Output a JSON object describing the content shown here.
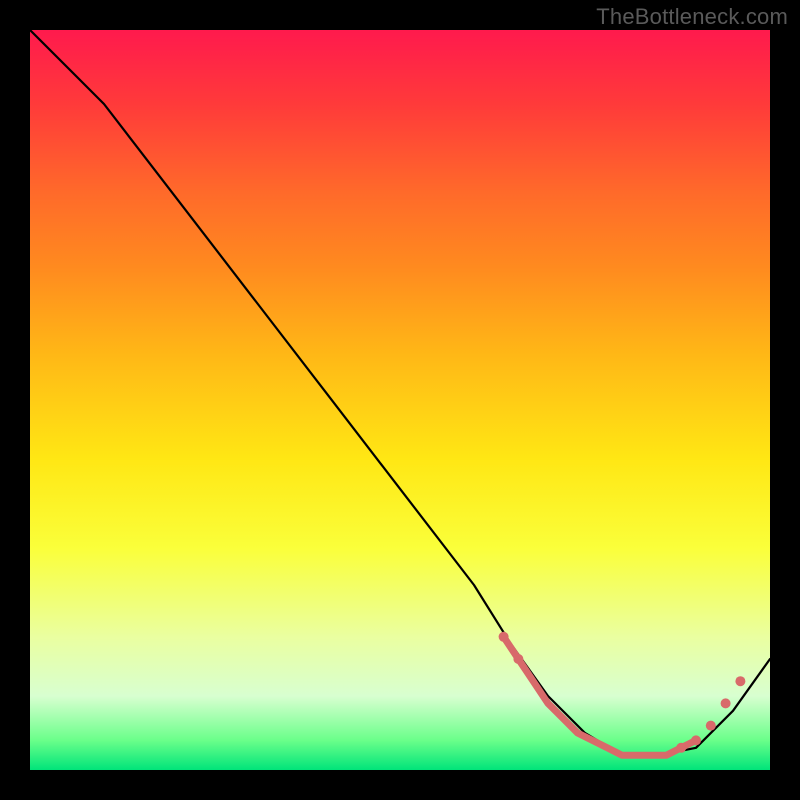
{
  "watermark": "TheBottleneck.com",
  "chart_data": {
    "type": "line",
    "title": "",
    "xlabel": "",
    "ylabel": "",
    "xlim": [
      0,
      100
    ],
    "ylim": [
      0,
      100
    ],
    "grid": false,
    "legend": false,
    "curve": {
      "name": "bottleneck-curve",
      "color": "#000000",
      "x": [
        0,
        6,
        10,
        20,
        30,
        40,
        50,
        60,
        65,
        70,
        75,
        80,
        85,
        90,
        95,
        100
      ],
      "y": [
        100,
        94,
        90,
        77,
        64,
        51,
        38,
        25,
        17,
        10,
        5,
        2,
        2,
        3,
        8,
        15
      ]
    },
    "highlight_band": {
      "name": "optimal-range-markers",
      "color": "#d86a6a",
      "x": [
        64,
        66,
        68,
        70,
        72,
        74,
        76,
        78,
        80,
        82,
        84,
        86,
        88,
        90,
        92,
        94,
        96
      ],
      "y": [
        18,
        15,
        12,
        9,
        7,
        5,
        4,
        3,
        2,
        2,
        2,
        2,
        3,
        4,
        6,
        9,
        12
      ]
    }
  }
}
